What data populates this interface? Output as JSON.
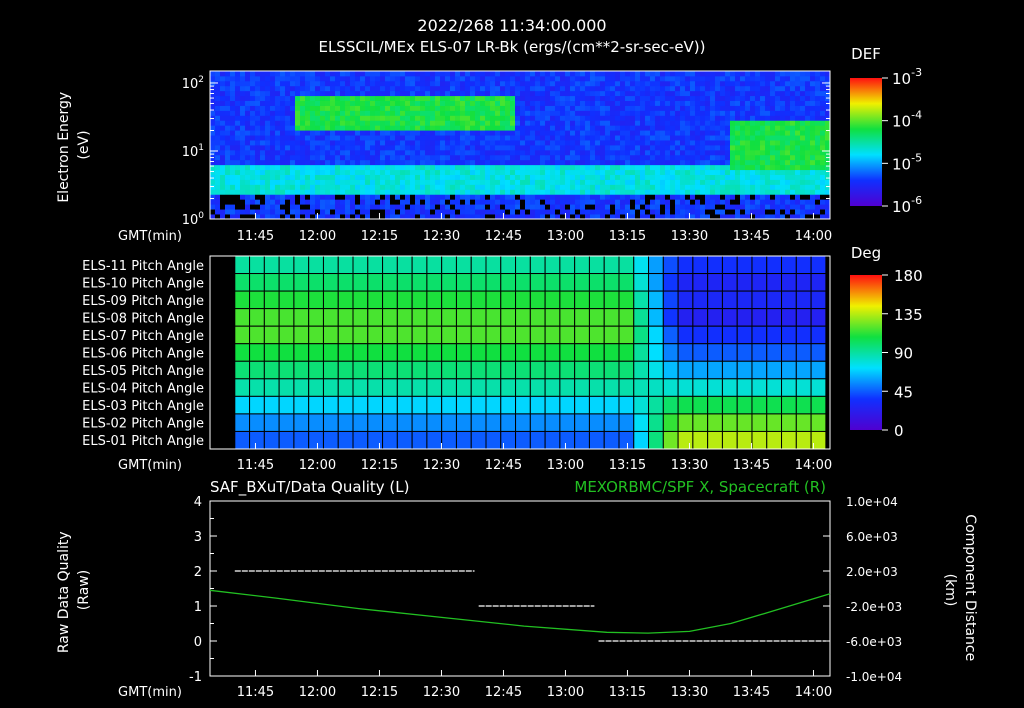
{
  "header": {
    "datetime": "2022/268 11:34:00.000",
    "subtitle": "ELSSCIL/MEx ELS-07 LR-Bk  (ergs/(cm**2-sr-sec-eV))"
  },
  "colors": {
    "background": "#000000",
    "axis": "#ffffff",
    "spacecraft_line": "#22c022",
    "quality_line": "#ffffff"
  },
  "time_axis": {
    "label": "GMT(min)",
    "ticks": [
      "11:45",
      "12:00",
      "12:15",
      "12:30",
      "12:45",
      "13:00",
      "13:15",
      "13:30",
      "13:45",
      "14:00"
    ],
    "tick_minutes": [
      45,
      60,
      75,
      90,
      105,
      120,
      135,
      150,
      165,
      180
    ],
    "range_minutes": [
      34,
      184
    ]
  },
  "chart_data": [
    {
      "type": "heatmap",
      "ylabel": "Electron Energy\n(eV)",
      "yscale": "log",
      "ylim": [
        1,
        150
      ],
      "y_ticks": [
        "10^0",
        "10^1",
        "10^2"
      ],
      "colorbar": {
        "title": "DEF",
        "scale": "log",
        "range": [
          1e-06,
          0.001
        ],
        "ticks": [
          "10^-3",
          "10^-4",
          "10^-5",
          "10^-6"
        ]
      },
      "features": [
        {
          "minutes": [
            34,
            184
          ],
          "energy_eV": [
            2.5,
            6
          ],
          "level": "1e-5 to 3e-5"
        },
        {
          "minutes": [
            55,
            108
          ],
          "energy_eV": [
            20,
            60
          ],
          "level": "~1e-4"
        },
        {
          "minutes": [
            160,
            184
          ],
          "energy_eV": [
            5,
            30
          ],
          "level": "~1e-4"
        }
      ]
    },
    {
      "type": "heatmap",
      "rows": [
        "ELS-11 Pitch Angle",
        "ELS-10 Pitch Angle",
        "ELS-09 Pitch Angle",
        "ELS-08 Pitch Angle",
        "ELS-07 Pitch Angle",
        "ELS-06 Pitch Angle",
        "ELS-05 Pitch Angle",
        "ELS-04 Pitch Angle",
        "ELS-03 Pitch Angle",
        "ELS-02 Pitch Angle",
        "ELS-01 Pitch Angle"
      ],
      "colorbar": {
        "title": "Deg",
        "range": [
          0,
          180
        ],
        "ticks": [
          "180",
          "135",
          "90",
          "45",
          "0"
        ]
      },
      "columns_start_minute": 40,
      "columns_end_minute": 183,
      "column_count": 40,
      "left_segment_deg": [
        90,
        100,
        110,
        117,
        118,
        108,
        98,
        88,
        70,
        55,
        45
      ],
      "right_segment_deg": [
        35,
        28,
        30,
        25,
        35,
        45,
        60,
        80,
        105,
        122,
        135
      ],
      "transition_minute": [
        135,
        147
      ]
    },
    {
      "type": "line",
      "title_left": "SAF_BXuT/Data Quality (L)",
      "title_right": "MEXORBMC/SPF X, Spacecraft (R)",
      "ylabel_left": "Raw Data Quality\n(Raw)",
      "ylabel_right": "Component Distance\n(km)",
      "ylim_left": [
        -1,
        4
      ],
      "y_ticks_left": [
        "4",
        "3",
        "2",
        "1",
        "0",
        "-1"
      ],
      "ylim_right": [
        -10000,
        10000
      ],
      "y_ticks_right": [
        "1.0e+04",
        "6.0e+03",
        "2.0e+03",
        "-2.0e+03",
        "-6.0e+03",
        "-1.0e+04"
      ],
      "series": [
        {
          "name": "Data Quality",
          "axis": "left",
          "segments": [
            {
              "x": [
                40,
                98
              ],
              "y": 2.0
            },
            {
              "x": [
                99,
                127
              ],
              "y": 1.0
            },
            {
              "x": [
                128,
                183
              ],
              "y": 0.0
            }
          ]
        },
        {
          "name": "SPF X, Spacecraft",
          "axis": "right",
          "x": [
            34,
            50,
            70,
            90,
            110,
            130,
            140,
            150,
            160,
            170,
            184
          ],
          "y": [
            -200,
            -1100,
            -2300,
            -3300,
            -4300,
            -5000,
            -5100,
            -4900,
            -4000,
            -2600,
            -600
          ]
        }
      ]
    }
  ]
}
